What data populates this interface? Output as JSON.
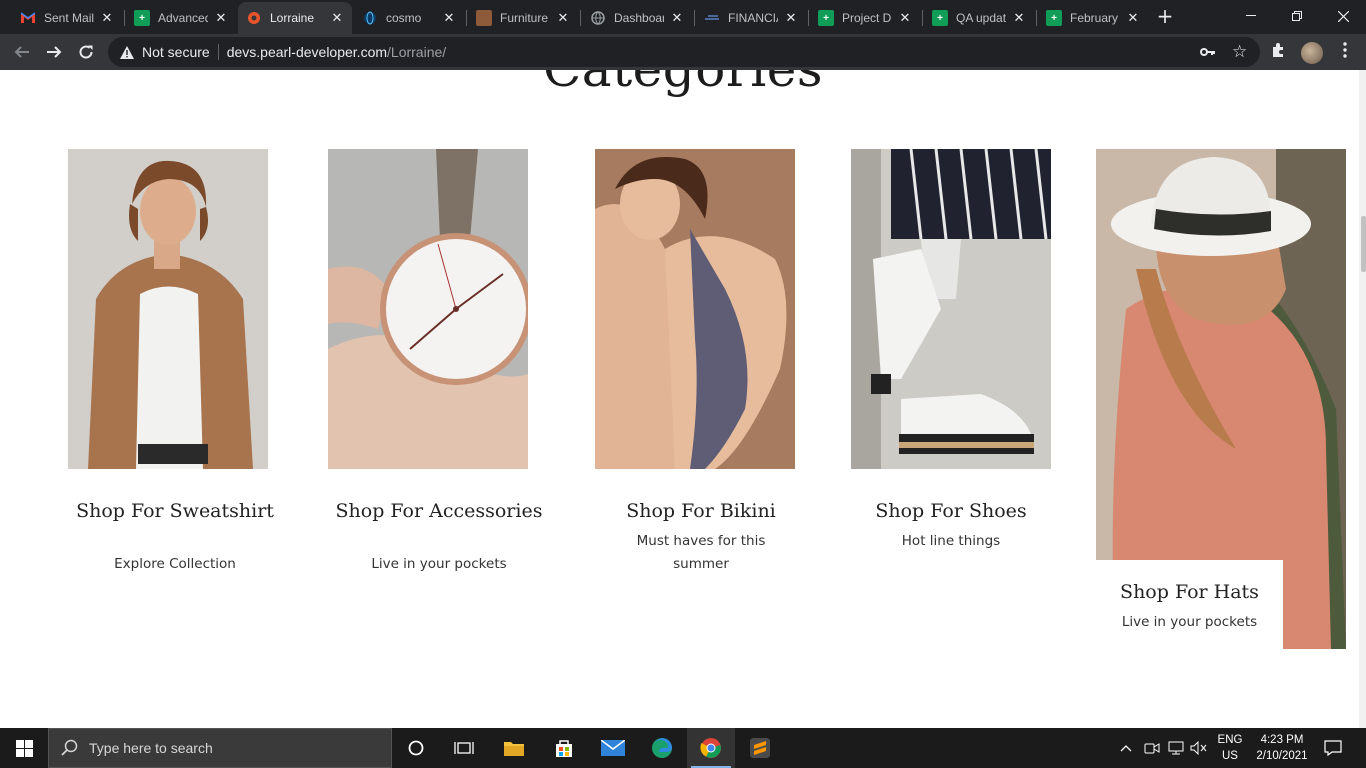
{
  "browser": {
    "tabs": [
      {
        "title": "Sent Mail",
        "icon": "gmail-icon",
        "color": "#ea4335",
        "active": false
      },
      {
        "title": "Advanced",
        "icon": "sheets-icon",
        "color": "#0f9d58",
        "active": false
      },
      {
        "title": "Lorraine",
        "icon": "site-icon",
        "color": "#e8552b",
        "active": true
      },
      {
        "title": "cosmo",
        "icon": "globe-icon",
        "color": "#1e88e5",
        "active": false
      },
      {
        "title": "Furniture",
        "icon": "furniture-icon",
        "color": "#8d5b3a",
        "active": false
      },
      {
        "title": "Dashboar",
        "icon": "globe-icon",
        "color": "#9aa0a6",
        "active": false
      },
      {
        "title": "FINANCIA",
        "icon": "finance-icon",
        "color": "#5b7ec7",
        "active": false
      },
      {
        "title": "Project D",
        "icon": "sheets-icon",
        "color": "#0f9d58",
        "active": false
      },
      {
        "title": "QA updat",
        "icon": "sheets-icon",
        "color": "#0f9d58",
        "active": false
      },
      {
        "title": "February",
        "icon": "sheets-icon",
        "color": "#0f9d58",
        "active": false
      }
    ],
    "security_label": "Not secure",
    "url_host": "devs.pearl-developer.com",
    "url_path": "/Lorraine/"
  },
  "page": {
    "section_title": "Categories",
    "cards": [
      {
        "title": "Shop For Sweatshirt",
        "subtitle": "Explore Collection",
        "image": "man-in-brown-blazer"
      },
      {
        "title": "Shop For Accessories",
        "subtitle": "Live in your pockets",
        "image": "wrist-watch"
      },
      {
        "title": "Shop For Bikini",
        "subtitle": "Must haves for this summer",
        "image": "woman-in-swimsuit"
      },
      {
        "title": "Shop For Shoes",
        "subtitle": "Hot line things",
        "image": "white-platform-shoes"
      },
      {
        "title": "Shop For Hats",
        "subtitle": "Live in your pockets",
        "image": "woman-in-white-hat"
      }
    ]
  },
  "taskbar": {
    "search_placeholder": "Type here to search",
    "language": "ENG",
    "region": "US",
    "time": "4:23 PM",
    "date": "2/10/2021"
  }
}
